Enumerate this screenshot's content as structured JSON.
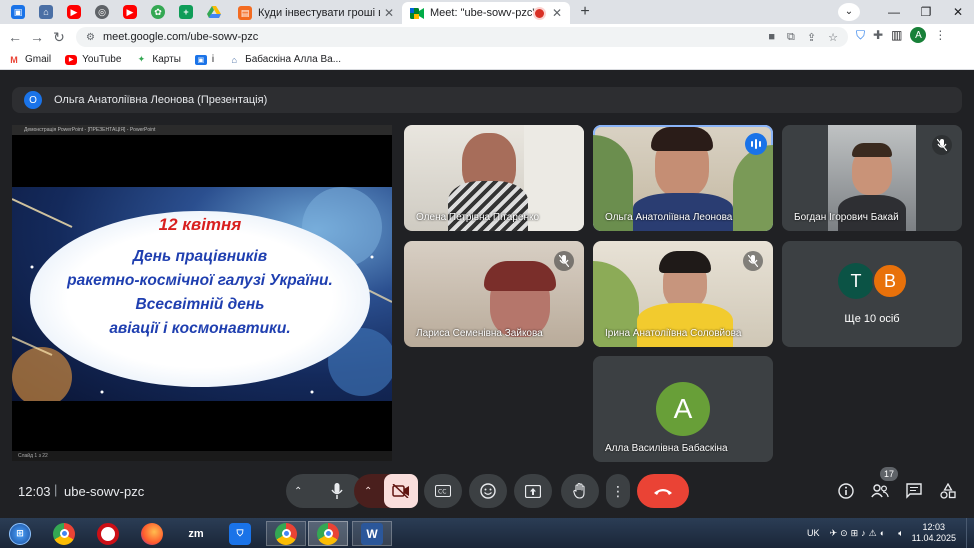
{
  "browser": {
    "tabs": [
      {
        "label": "Куди інвестувати гроші в Украї",
        "active": false
      },
      {
        "label": "Meet: \"ube-sowv-pzc\"",
        "active": true
      }
    ],
    "url": "meet.google.com/ube-sowv-pzc",
    "profile_initial": "A"
  },
  "bookmarks": [
    {
      "label": "Gmail",
      "icon": "gmail-icon"
    },
    {
      "label": "YouTube",
      "icon": "youtube-icon"
    },
    {
      "label": "Карты",
      "icon": "maps-icon"
    },
    {
      "label": "i",
      "icon": "contacts-icon"
    },
    {
      "label": "Бабаскіна Алла Ва...",
      "icon": "home-icon"
    }
  ],
  "meet": {
    "presenter_badge": "О",
    "presenter_label": "Ольга Анатоліївна Леонова (Презентація)",
    "presentation_window_title": "Демонстрація PowerPoint - [ПРЕЗЕНТАЦІЯ] - PowerPoint",
    "presentation_footer": "Слайд 1 з 22",
    "slide": {
      "line1": "12 квітня",
      "line2": "День працівників",
      "line3": "ракетно-космічної галузі України.",
      "line4": "Всесвітній день",
      "line5": "авіації і космонавтики."
    },
    "participants": [
      {
        "name": "Олена Петрівна Пітаренко"
      },
      {
        "name": "Ольга Анатоліївна Леонова",
        "speaking": true
      },
      {
        "name": "Богдан Ігорович Бакай",
        "muted": true
      },
      {
        "name": "Лариса Семенівна Зайкова",
        "muted": true
      },
      {
        "name": "Ірина Анатоліївна Соловйова",
        "muted": true
      },
      {
        "name": "Алла Василівна Бабаскіна",
        "initial": "А"
      }
    ],
    "others": {
      "initials": [
        "T",
        "B"
      ],
      "label": "Ще 10 осіб"
    },
    "time": "12:03",
    "code": "ube-sowv-pzc",
    "people_count": "17"
  },
  "taskbar": {
    "lang": "UK",
    "time": "12:03",
    "date": "11.04.2025",
    "zoom_label": "zm"
  },
  "colors": {
    "end_call": "#ea4335",
    "camera_off": "#f9dedc",
    "accent": "#1a73e8"
  }
}
